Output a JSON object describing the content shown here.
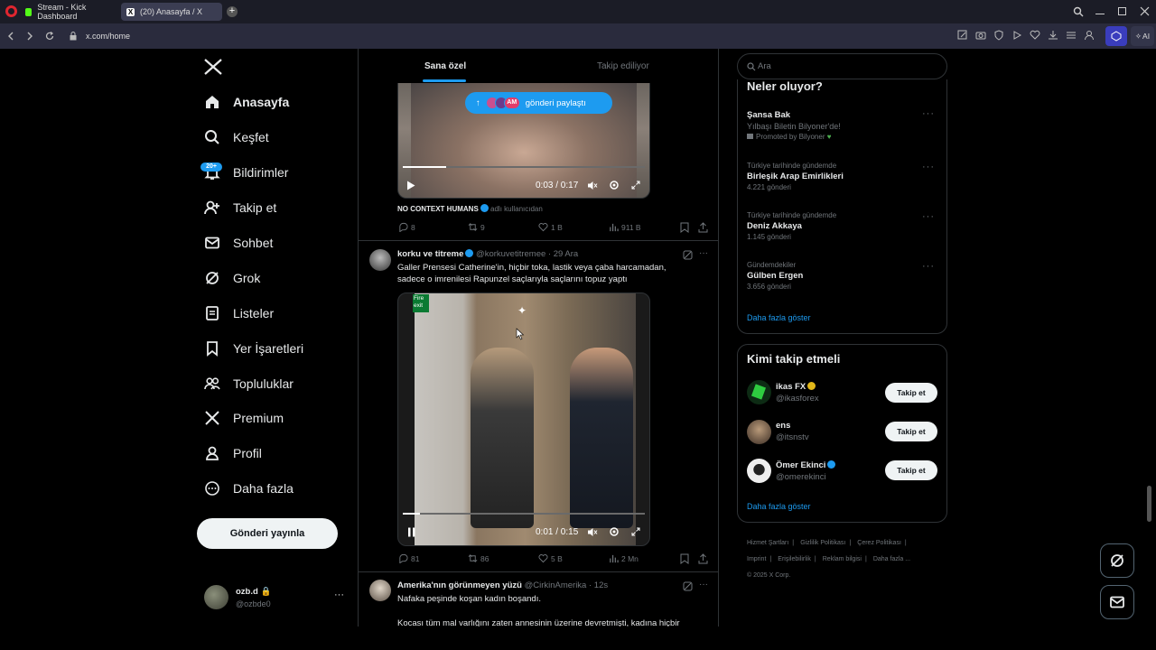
{
  "browser": {
    "tabs": [
      {
        "label": "Stream - Kick Dashboard"
      },
      {
        "label": "(20) Anasayfa / X"
      }
    ],
    "url": "x.com/home",
    "ai_label": "AI"
  },
  "nav": {
    "items": [
      {
        "label": "Anasayfa"
      },
      {
        "label": "Keşfet"
      },
      {
        "label": "Bildirimler",
        "badge": "20+"
      },
      {
        "label": "Takip et"
      },
      {
        "label": "Sohbet"
      },
      {
        "label": "Grok"
      },
      {
        "label": "Listeler"
      },
      {
        "label": "Yer İşaretleri"
      },
      {
        "label": "Topluluklar"
      },
      {
        "label": "Premium"
      },
      {
        "label": "Profil"
      },
      {
        "label": "Daha fazla"
      }
    ],
    "post_button": "Gönderi yayınla",
    "account": {
      "name": "ozb.d",
      "handle": "@ozbde0",
      "more": "···"
    }
  },
  "feed": {
    "tabs": [
      {
        "label": "Sana özel"
      },
      {
        "label": "Takip ediliyor"
      }
    ],
    "shared_pill": "gönderi paylaştı",
    "pill_avatar_text": "AM",
    "post1": {
      "time": "0:03 / 0:17",
      "progress": 0.18,
      "caption_name": "NO CONTEXT HUMANS",
      "caption_rest": "adlı kullanıcıdan",
      "replies": "8",
      "reposts": "9",
      "likes": "1 B",
      "views": "911 B"
    },
    "post2": {
      "name": "korku ve titreme",
      "handle": "@korkuvetitremee",
      "date": "· 29 Ara",
      "text1": "Galler Prensesi Catherine'in, hiçbir toka, lastik veya çaba harcamadan,",
      "text2": "sadece o imrenilesi Rapunzel saçlarıyla saçlarını topuz yaptı",
      "fire_exit": "Fire exit",
      "time": "0:01 / 0:15",
      "progress": 0.07,
      "replies": "81",
      "reposts": "86",
      "likes": "5 B",
      "views": "2 Mn"
    },
    "post3": {
      "name": "Amerika'nın görünmeyen yüzü",
      "handle": "@CirkinAmerika",
      "date": "· 12s",
      "text1": "Nafaka peşinde koşan kadın boşandı.",
      "text2": "Kocası tüm mal varlığını zaten annesinin üzerine devretmişti, kadına hiçbir"
    }
  },
  "sidebar": {
    "search_placeholder": "Ara",
    "trends_title": "Neler oluyor?",
    "trends": [
      {
        "category": "",
        "title": "Şansa Bak",
        "sub": "Yılbaşı Biletin Bilyoner'de!",
        "promo": "Promoted by Bilyoner"
      },
      {
        "category": "Türkiye tarihinde gündemde",
        "title": "Birleşik Arap Emirlikleri",
        "sub": "4.221 gönderi"
      },
      {
        "category": "Türkiye tarihinde gündemde",
        "title": "Deniz Akkaya",
        "sub": "1.145 gönderi"
      },
      {
        "category": "Gündemdekiler",
        "title": "Gülben Ergen",
        "sub": "3.656 gönderi"
      }
    ],
    "show_more": "Daha fazla göster",
    "who_title": "Kimi takip etmeli",
    "who": [
      {
        "name": "ikas FX",
        "handle": "@ikasforex",
        "button": "Takip et"
      },
      {
        "name": "ens",
        "handle": "@itsnstv",
        "button": "Takip et"
      },
      {
        "name": "Ömer Ekinci",
        "handle": "@omerekinci",
        "button": "Takip et"
      }
    ],
    "who_more": "Daha fazla göster",
    "footer": [
      "Hizmet Şartları",
      "|",
      "Gizlilik Politikası",
      "|",
      "Çerez Politikası",
      "|",
      "Imprint",
      "|",
      "Erişilebilirlik",
      "|",
      "Reklam bilgisi",
      "|",
      "Daha fazla ...",
      "© 2025 X Corp."
    ]
  },
  "colors": {
    "accent": "#1d9bf0",
    "bg": "#000000",
    "border": "#2f3336",
    "muted": "#71767b"
  }
}
